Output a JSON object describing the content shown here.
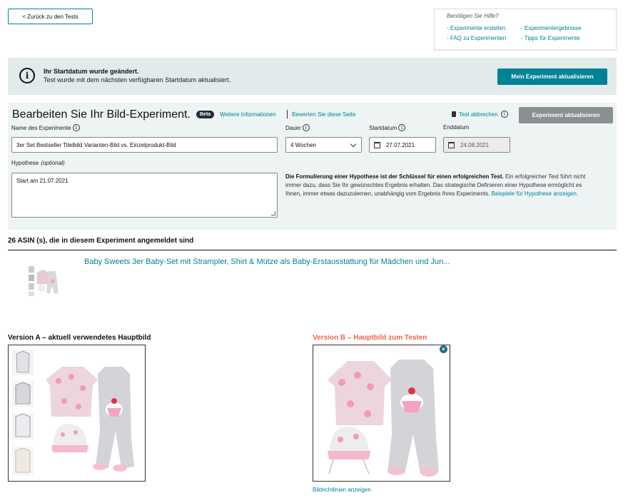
{
  "nav": {
    "back_label": "< Zurück zu den Tests"
  },
  "help": {
    "title": "Benötigen Sie Hilfe?",
    "links": [
      "- Experimente erstellen",
      "- Experimentergebnisse",
      "- FAQ zu Experimenten",
      "- Tipps für Experimente"
    ]
  },
  "notice": {
    "title": "Ihr Startdatum wurde geändert.",
    "message": "Test wurde mit dem nächsten verfügbaren Startdatum aktualisiert.",
    "button_label": "Mein Experiment aktualisieren"
  },
  "editor": {
    "title": "Bearbeiten Sie Ihr Bild-Experiment.",
    "beta_label": "Beta",
    "more_info": "Weitere Informationen",
    "rate_page": "Bewerten Sie diese Seite",
    "cancel_label": "Test abbrechen",
    "update_label": "Experiment aktualisieren",
    "name_label": "Name des Experimente",
    "name_value": "3er Set Bestseller Titelbild Varianten-Bild vs. Einzelprodukt-Bild",
    "duration_label": "Dauer",
    "duration_value": "4 Wochen",
    "start_label": "Startdatum",
    "start_value": "27.07.2021",
    "end_label": "Enddatum",
    "end_value": "24.08.2021",
    "hypothesis_label": "Hypothese",
    "hypothesis_optional": "(optional)",
    "hypothesis_value": "Start am 21.07.2021",
    "hypothesis_help_bold": "Die Formulierung einer Hypothese ist der Schlüssel für einen erfolgreichen Test.",
    "hypothesis_help_text": "Ein erfolgreicher Test führt nicht immer dazu, dass Sie Ihr gewünschtes Ergebnis erhalten. Das strategische Definieren einer Hypothese ermöglicht es Ihnen, immer etwas dazuzulernen, unabhängig vom Ergebnis Ihres Experiments.",
    "hypothesis_help_link": "Beispiele für Hypothese anzeigen."
  },
  "asin": {
    "heading": "26 ASIN (s), die in diesem Experiment angemeldet sind",
    "product_title": "Baby Sweets 3er Baby-Set mit Strampler, Shirt & Mütze als Baby-Erstausstattung für Mädchen und Jun..."
  },
  "versions": {
    "a_title": "Version A – aktuell verwendetes Hauptbild",
    "b_title": "Version B – Hauptbild zum Testen",
    "close_glyph": "×",
    "guidelines_link": "Bildrichtlinien anzeigen"
  },
  "colors": {
    "accent": "#008296",
    "version_b": "#e8684a",
    "disabled_button": "#8a8f91"
  }
}
